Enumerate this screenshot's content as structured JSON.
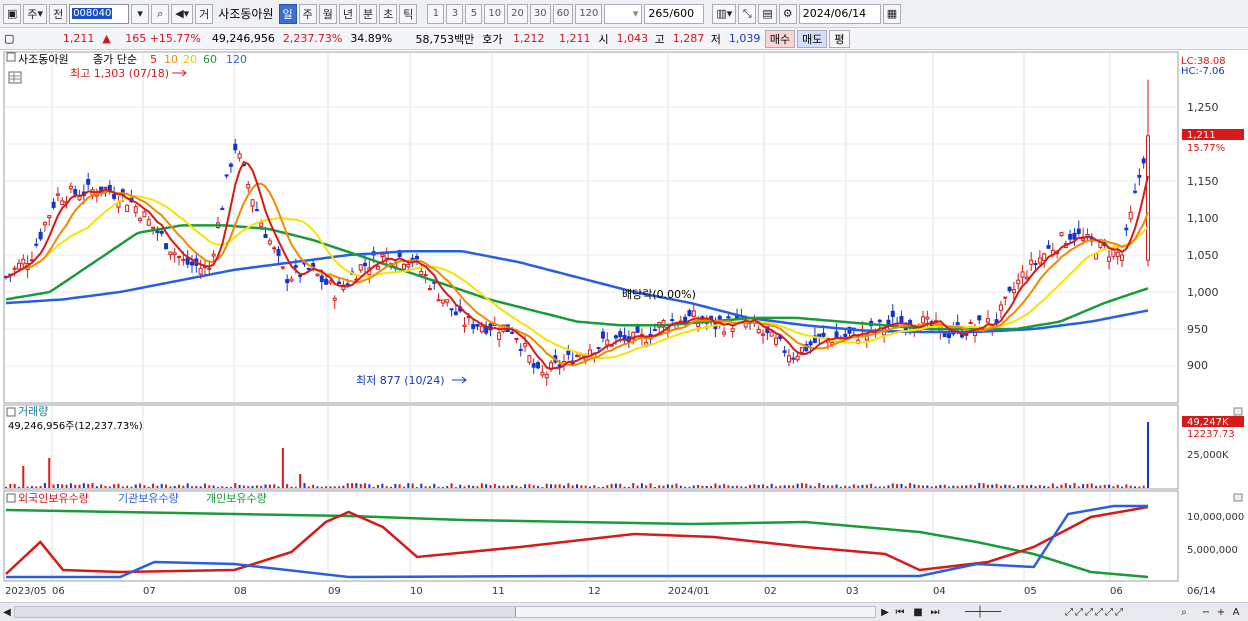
{
  "toolbar": {
    "type_label": "주",
    "prev_label": "전",
    "code": "008040",
    "trade_label": "거",
    "stock_name": "사조동아원",
    "periods": [
      "일",
      "주",
      "월",
      "년",
      "분",
      "초",
      "틱"
    ],
    "active_period": "일",
    "intervals": [
      "1",
      "3",
      "5",
      "10",
      "20",
      "30",
      "60",
      "120"
    ],
    "count": "265",
    "count_max": "/600",
    "date": "2024/06/14"
  },
  "quote": {
    "price": "1,211",
    "change": "165 +15.77%",
    "volume": "49,246,956",
    "volume_ratio": "2,237.73%",
    "turnover": "34.89%",
    "amount": "58,753백만",
    "bid_label": "호가",
    "ask": "1,212",
    "bid": "1,211",
    "open_label": "시",
    "open": "1,043",
    "high_label": "고",
    "high": "1,287",
    "low_label": "저",
    "low": "1,039",
    "buy": "매수",
    "sell": "매도",
    "eval": "평"
  },
  "price_panel": {
    "legend_name": "사조동아원",
    "legend_ma": "종가 단순",
    "ma_periods": [
      "5",
      "10",
      "20",
      "60",
      "120"
    ],
    "ma_colors": [
      "#d61a1a",
      "#f08a00",
      "#f5e400",
      "#1a9a3a",
      "#2a5ee0"
    ],
    "lc": "LC:38.08",
    "hc": "HC:-7.06",
    "current_price": "1,211",
    "current_change": "15.77%",
    "high_annotation": "최고 1,303 (07/18)",
    "low_annotation": "최저 877 (10/24)",
    "dividend_annotation": "배당락(0.00%)",
    "y_ticks": [
      "1,250",
      "1,200",
      "1,150",
      "1,100",
      "1,050",
      "1,000",
      "950",
      "900"
    ]
  },
  "volume_panel": {
    "title": "거래량",
    "value_text": "49,246,956주(12,237.73%)",
    "current": "49,247K",
    "current_ratio": "12237.73",
    "y_tick": "25,000K"
  },
  "holding_panel": {
    "series": [
      "외국인보유수량",
      "기관보유수량",
      "개인보유수량"
    ],
    "series_colors": [
      "#d61a1a",
      "#2a5ee0",
      "#1a9a3a"
    ],
    "y_ticks": [
      "10,000,000",
      "5,000,000"
    ]
  },
  "x_axis": [
    "2023/05",
    "06",
    "07",
    "08",
    "09",
    "10",
    "11",
    "12",
    "2024/01",
    "02",
    "03",
    "04",
    "05",
    "06",
    "06/14"
  ],
  "chart_data": {
    "type": "candlestick",
    "approx_closes": [
      1020,
      1050,
      1130,
      1135,
      1140,
      1120,
      1080,
      1040,
      1030,
      1200,
      1100,
      1020,
      1030,
      1000,
      1035,
      1050,
      1045,
      1000,
      960,
      955,
      950,
      885,
      905,
      925,
      935,
      935,
      960,
      965,
      955,
      960,
      940,
      915,
      935,
      940,
      945,
      960,
      960,
      945,
      950,
      960,
      1020,
      1055,
      1080,
      1060,
      1050,
      1211
    ],
    "ma60_approx": [
      990,
      1000,
      1040,
      1080,
      1090,
      1090,
      1085,
      1070,
      1050,
      1030,
      1010,
      990,
      975,
      960,
      955,
      955,
      960,
      965,
      965,
      960,
      955,
      950,
      950,
      950,
      960,
      985,
      1005
    ],
    "ma120_approx": [
      985,
      990,
      1000,
      1015,
      1030,
      1040,
      1050,
      1055,
      1055,
      1040,
      1020,
      1000,
      985,
      965,
      955,
      948,
      946,
      946,
      950,
      960,
      975
    ]
  }
}
